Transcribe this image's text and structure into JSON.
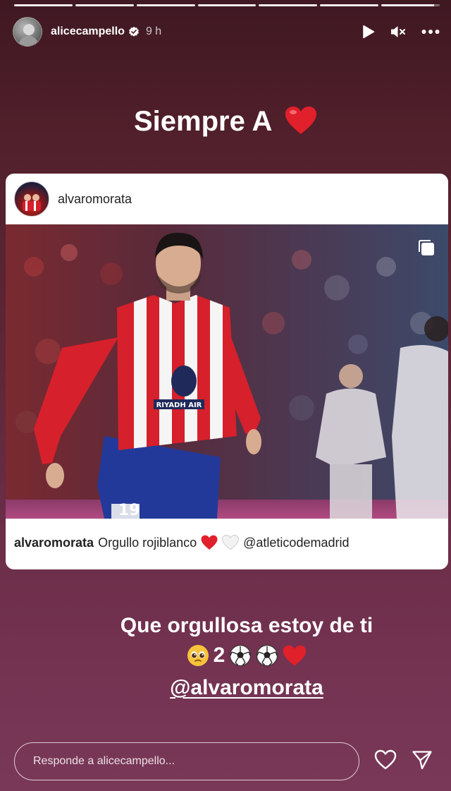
{
  "story": {
    "progress_segments_complete": 6,
    "progress_last_fraction": 0.9,
    "username": "alicecampello",
    "time_ago": "9 h",
    "title_text": "Siempre A",
    "icons": [
      "play-icon",
      "mute-icon",
      "more-icon",
      "verified-badge-icon",
      "heart-emoji-icon"
    ]
  },
  "post": {
    "username": "alvaromorata",
    "caption_user": "alvaromorata",
    "caption_text": "Orgullo rojiblanco",
    "caption_mention": "@atleticodemadrid",
    "photo_text": {
      "sponsor": "RIYADH AIR",
      "number": "19"
    },
    "icons": [
      "multiple-photos-icon",
      "red-heart-emoji",
      "white-heart-emoji"
    ]
  },
  "message": {
    "line1": "Que orgullosa estoy de ti",
    "count": "2",
    "mention": "@alvaromorata",
    "emojis": [
      "pleading-face",
      "soccer-ball",
      "soccer-ball",
      "red-heart"
    ]
  },
  "footer": {
    "reply_placeholder": "Responde a alicecampello...",
    "icons": [
      "like-heart-icon",
      "share-send-icon"
    ]
  },
  "colors": {
    "background_top": "#3f1822",
    "background_bottom": "#7a3859",
    "heart_red": "#e0202a",
    "atletico_red": "#d6202b",
    "atletico_blue": "#23399a"
  }
}
